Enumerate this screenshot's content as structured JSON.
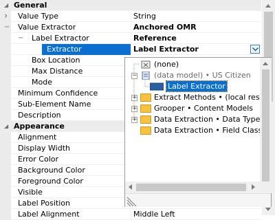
{
  "property_grid": {
    "rows": [
      {
        "type": "category",
        "name": "General"
      },
      {
        "type": "prop",
        "name": "Value Type",
        "value": "String",
        "expander": "chevron"
      },
      {
        "type": "prop",
        "name": "Value Extractor",
        "value": "Anchored OMR",
        "expander": "minus",
        "value_bold": true
      },
      {
        "type": "prop",
        "name": "Label Extractor",
        "value": "Reference",
        "expander": "minus",
        "value_bold": true
      },
      {
        "type": "prop",
        "name": "Extractor",
        "value": "Label Extractor",
        "selected": true,
        "value_bold": true
      },
      {
        "type": "prop",
        "name": "Box Location",
        "value": ""
      },
      {
        "type": "prop",
        "name": "Max Distance",
        "value": ""
      },
      {
        "type": "prop",
        "name": "Mode",
        "value": ""
      },
      {
        "type": "prop",
        "name": "Minimum Confidence",
        "value": ""
      },
      {
        "type": "prop",
        "name": "Sub-Element Name",
        "value": ""
      },
      {
        "type": "prop",
        "name": "Description",
        "value": ""
      },
      {
        "type": "category",
        "name": "Appearance"
      },
      {
        "type": "prop",
        "name": "Alignment",
        "value": ""
      },
      {
        "type": "prop",
        "name": "Display Width",
        "value": ""
      },
      {
        "type": "prop",
        "name": "Error Color",
        "value": ""
      },
      {
        "type": "prop",
        "name": "Background Color",
        "value": ""
      },
      {
        "type": "prop",
        "name": "Foreground Color",
        "value": ""
      },
      {
        "type": "prop",
        "name": "Visible",
        "value": ""
      },
      {
        "type": "prop",
        "name": "Label Position",
        "value": ""
      },
      {
        "type": "prop",
        "name": "Label Alignment",
        "value": "Middle Left"
      }
    ]
  },
  "dropdown_tree": {
    "items": [
      {
        "label": "(none)",
        "icon": "none-icon",
        "expander": "",
        "indent": 0
      },
      {
        "label": "(data model) • US Citizen",
        "icon": "data-model-icon",
        "expander": "minus",
        "indent": 0
      },
      {
        "label": "Label Extractor",
        "icon": "extractor-badge-icon",
        "expander": "",
        "indent": 1,
        "selected": true
      },
      {
        "label": "Extract Methods • (local resource)",
        "icon": "folder-icon",
        "expander": "plus",
        "indent": 0
      },
      {
        "label": "Grooper • Content Models",
        "icon": "folder-icon",
        "expander": "plus",
        "indent": 0
      },
      {
        "label": "Data Extraction • Data Types",
        "icon": "folder-icon",
        "expander": "plus",
        "indent": 0
      },
      {
        "label": "Data Extraction • Field Classes",
        "icon": "folder-icon",
        "expander": "",
        "indent": 0
      }
    ]
  },
  "colors": {
    "selection": "#0a6fd0",
    "category_bg": "#ececec"
  }
}
